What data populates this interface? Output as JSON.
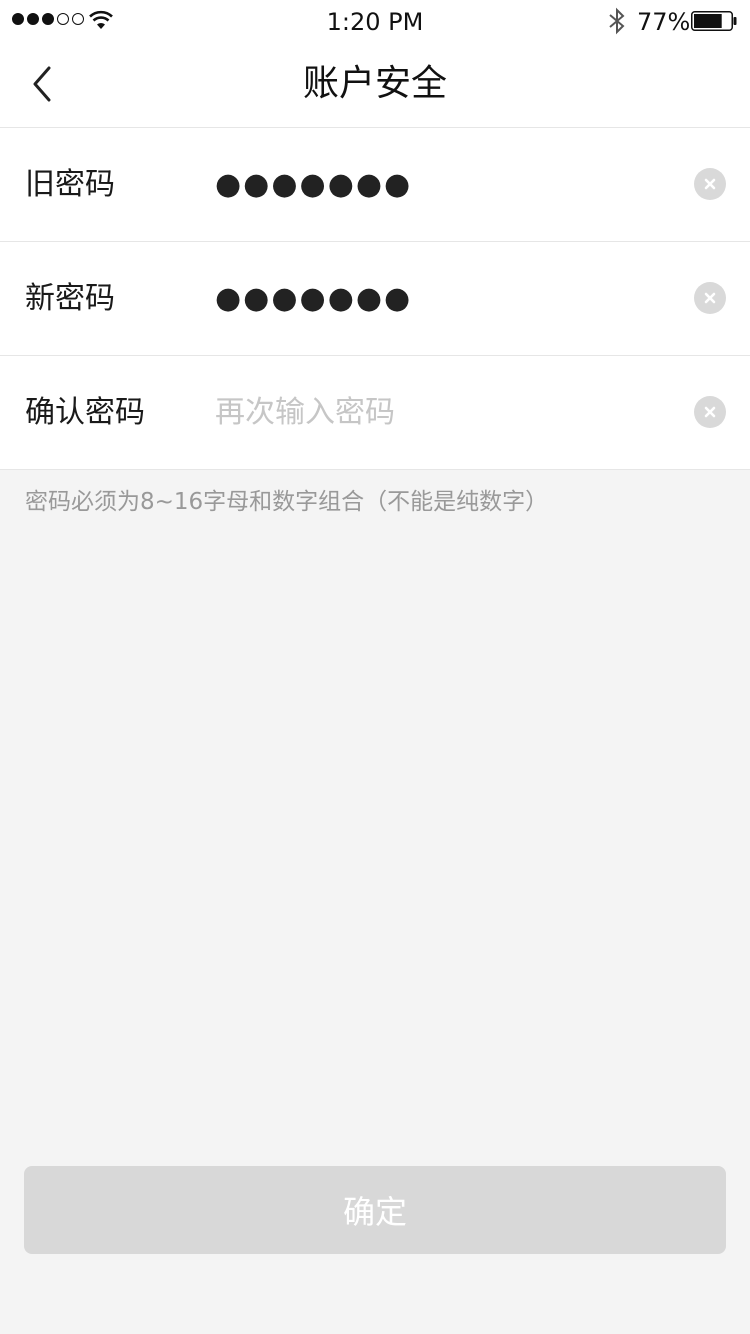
{
  "status_bar": {
    "time": "1:20 PM",
    "battery_percent": "77%",
    "battery_level": 0.77,
    "signal_bars_filled": 3,
    "signal_bars_total": 5,
    "icons": [
      "signal-dots-icon",
      "wifi-icon",
      "bluetooth-icon",
      "battery-icon"
    ]
  },
  "nav": {
    "title": "账户安全",
    "back_icon": "chevron-left-icon"
  },
  "form": {
    "rows": [
      {
        "label": "旧密码",
        "value": "●●●●●●●",
        "clear_icon": "clear-icon"
      },
      {
        "label": "新密码",
        "value": "●●●●●●●",
        "clear_icon": "clear-icon"
      },
      {
        "label": "确认密码",
        "value": "",
        "placeholder": "再次输入密码",
        "clear_icon": "clear-icon"
      }
    ]
  },
  "hint": "密码必须为8~16字母和数字组合（不能是纯数字）",
  "confirm_button": {
    "label": "确定"
  },
  "colors": {
    "background": "#f4f4f4",
    "button_disabled": "#d8d8d8",
    "placeholder": "#c6c6c6",
    "hint": "#999999"
  }
}
